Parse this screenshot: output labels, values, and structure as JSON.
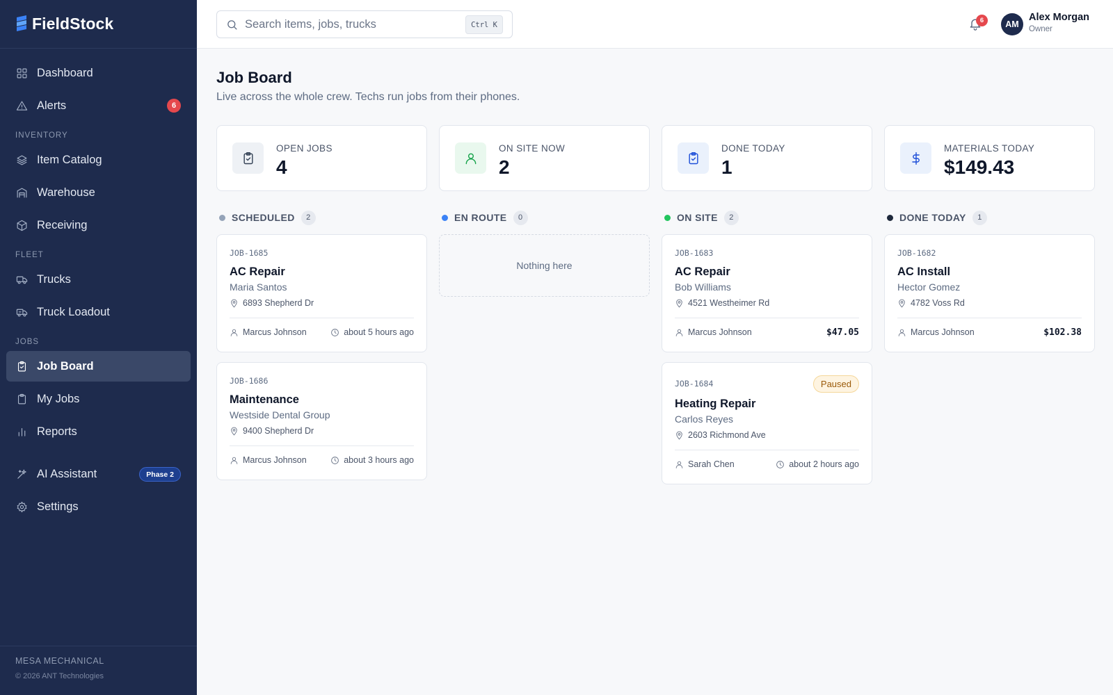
{
  "app": {
    "name": "FieldStock"
  },
  "sidebar": {
    "items_top": [
      {
        "label": "Dashboard",
        "icon": "dashboard-icon"
      },
      {
        "label": "Alerts",
        "icon": "alert-triangle-icon",
        "badge": "6"
      }
    ],
    "sections": {
      "inventory": "INVENTORY",
      "fleet": "FLEET",
      "jobs": "JOBS"
    },
    "inventory_items": [
      {
        "label": "Item Catalog",
        "icon": "layers-icon"
      },
      {
        "label": "Warehouse",
        "icon": "warehouse-icon"
      },
      {
        "label": "Receiving",
        "icon": "package-icon"
      }
    ],
    "fleet_items": [
      {
        "label": "Trucks",
        "icon": "truck-icon"
      },
      {
        "label": "Truck Loadout",
        "icon": "truck-loadout-icon"
      }
    ],
    "jobs_items": [
      {
        "label": "Job Board",
        "icon": "clipboard-check-icon",
        "active": true
      },
      {
        "label": "My Jobs",
        "icon": "clipboard-icon"
      },
      {
        "label": "Reports",
        "icon": "bar-chart-icon"
      }
    ],
    "bottom_items": [
      {
        "label": "AI Assistant",
        "icon": "sparkles-icon",
        "pill": "Phase 2"
      },
      {
        "label": "Settings",
        "icon": "gear-icon"
      }
    ],
    "footer": {
      "org": "MESA MECHANICAL",
      "copyright": "© 2026 ANT Technologies"
    }
  },
  "topbar": {
    "search_placeholder": "Search items, jobs, trucks",
    "search_shortcut": "Ctrl K",
    "notifications_count": "6",
    "user": {
      "initials": "AM",
      "name": "Alex Morgan",
      "role": "Owner"
    }
  },
  "page": {
    "title": "Job Board",
    "subtitle": "Live across the whole crew. Techs run jobs from their phones."
  },
  "stats": [
    {
      "label": "OPEN JOBS",
      "value": "4",
      "icon": "clipboard-check-icon"
    },
    {
      "label": "ON SITE NOW",
      "value": "2",
      "icon": "user-icon"
    },
    {
      "label": "DONE TODAY",
      "value": "1",
      "icon": "clipboard-check-icon"
    },
    {
      "label": "MATERIALS TODAY",
      "value": "$149.43",
      "icon": "dollar-icon"
    }
  ],
  "colors": {
    "sidebar_bg": "#1e2b4d",
    "scheduled_dot": "#94a3b8",
    "en_route_dot": "#3b82f6",
    "on_site_dot": "#22c55e",
    "done_dot": "#1e293b",
    "alert_badge": "#e5484d"
  },
  "columns": [
    {
      "title": "SCHEDULED",
      "count": "2",
      "cards": [
        {
          "id": "JOB-1685",
          "title": "AC Repair",
          "client": "Maria Santos",
          "address": "6893 Shepherd Dr",
          "tech": "Marcus Johnson",
          "time": "about 5 hours ago"
        },
        {
          "id": "JOB-1686",
          "title": "Maintenance",
          "client": "Westside Dental Group",
          "address": "9400 Shepherd Dr",
          "tech": "Marcus Johnson",
          "time": "about 3 hours ago"
        }
      ]
    },
    {
      "title": "EN ROUTE",
      "count": "0",
      "empty_text": "Nothing here",
      "cards": []
    },
    {
      "title": "ON SITE",
      "count": "2",
      "cards": [
        {
          "id": "JOB-1683",
          "title": "AC Repair",
          "client": "Bob Williams",
          "address": "4521 Westheimer Rd",
          "tech": "Marcus Johnson",
          "amount": "$47.05"
        },
        {
          "id": "JOB-1684",
          "title": "Heating Repair",
          "client": "Carlos Reyes",
          "address": "2603 Richmond Ave",
          "tech": "Sarah Chen",
          "time": "about 2 hours ago",
          "status": "Paused"
        }
      ]
    },
    {
      "title": "DONE TODAY",
      "count": "1",
      "cards": [
        {
          "id": "JOB-1682",
          "title": "AC Install",
          "client": "Hector Gomez",
          "address": "4782 Voss Rd",
          "tech": "Marcus Johnson",
          "amount": "$102.38"
        }
      ]
    }
  ]
}
